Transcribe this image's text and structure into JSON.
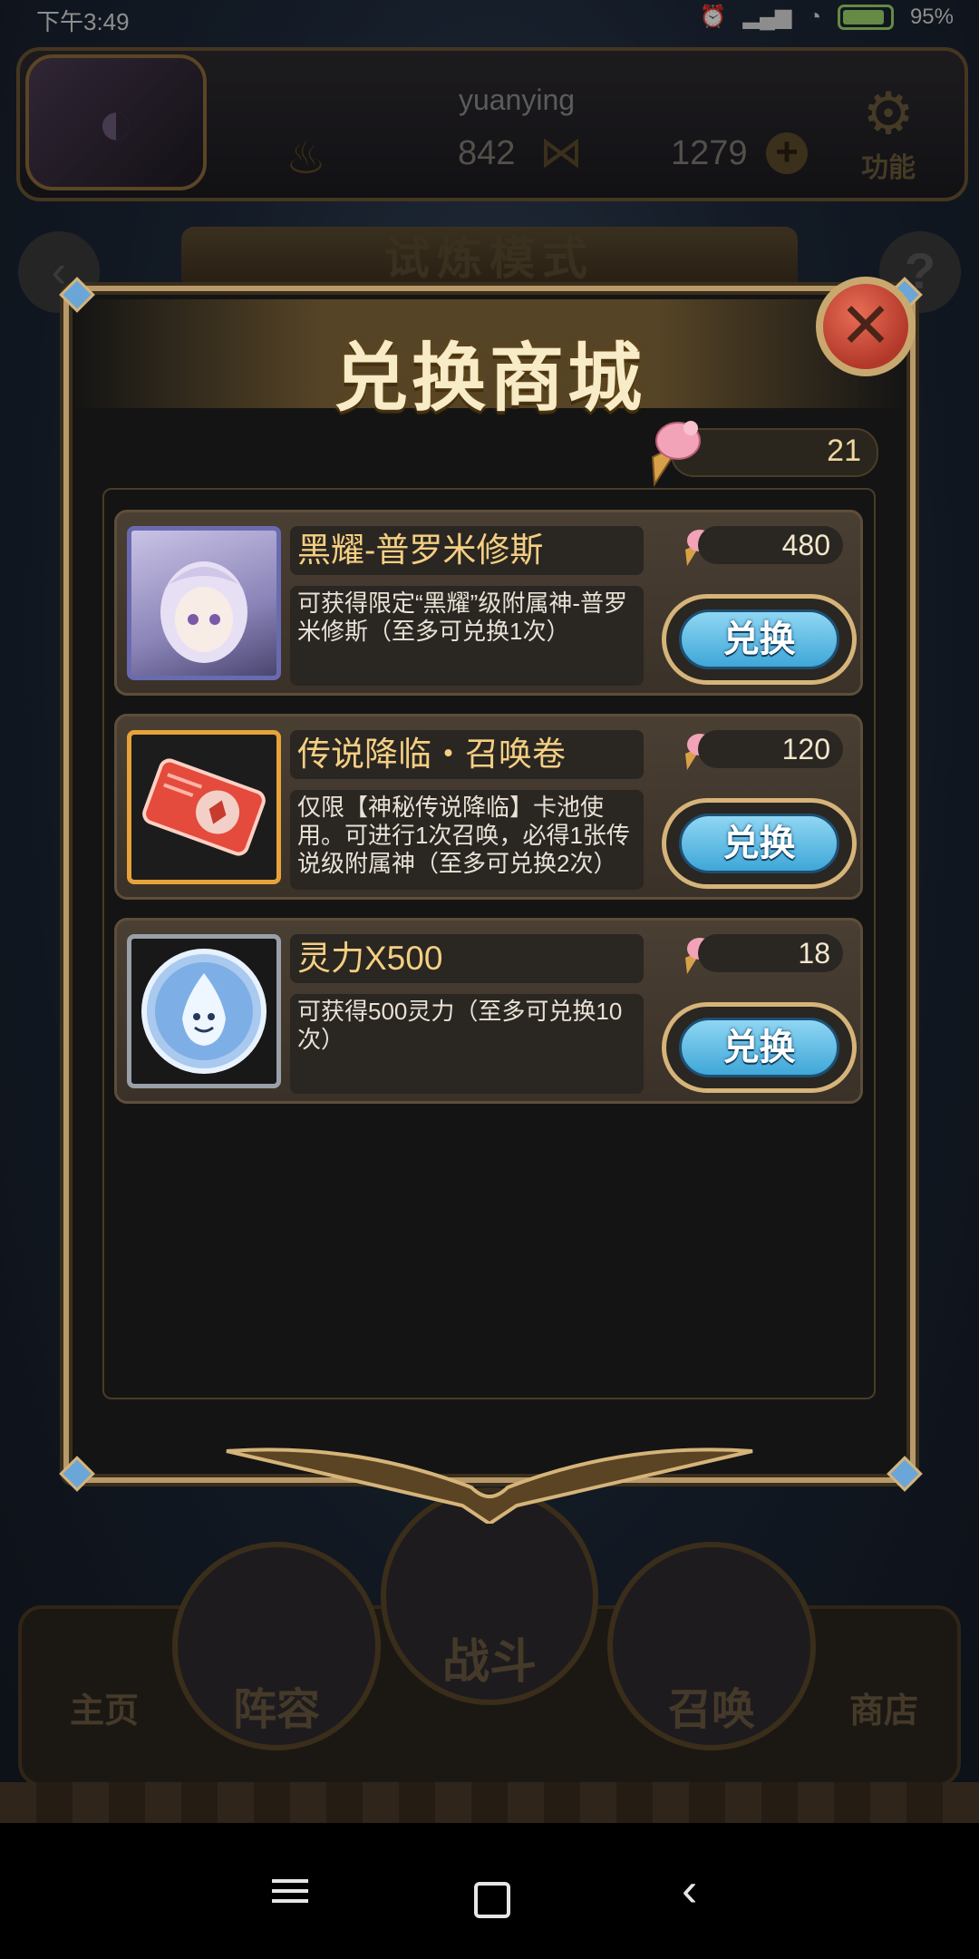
{
  "status_bar": {
    "time": "下午3:49",
    "battery": "95%"
  },
  "player": {
    "name": "yuanying",
    "stat_a": "842",
    "stat_b": "1279"
  },
  "top_actions": {
    "function_label": "功能"
  },
  "background_mode_title": "试炼模式",
  "modal": {
    "title": "兑换商城",
    "close_symbol": "✕",
    "currency_amount": "21",
    "items": [
      {
        "name": "黑耀-普罗米修斯",
        "price": "480",
        "description": "可获得限定“黑耀”级附属神-普罗米修斯（至多可兑换1次）",
        "button_label": "兑换"
      },
      {
        "name": "传说降临・召唤卷",
        "price": "120",
        "description": "仅限【神秘传说降临】卡池使用。可进行1次召唤，必得1张传说级附属神（至多可兑换2次）",
        "button_label": "兑换"
      },
      {
        "name": "灵力X500",
        "price": "18",
        "description": "可获得500灵力（至多可兑换10次）",
        "button_label": "兑换"
      }
    ]
  },
  "bottom_nav": {
    "home": "主页",
    "lineup": "阵容",
    "battle": "战斗",
    "summon": "召唤",
    "shop": "商店"
  },
  "colors": {
    "gold_text": "#f4cf82",
    "button_blue": "#3fa7d8",
    "close_red": "#b2382a",
    "frame_gold": "#b8996a"
  },
  "icons": {
    "currency": "ice-cream-cone-icon",
    "close": "close-icon",
    "function": "gear-icon"
  }
}
